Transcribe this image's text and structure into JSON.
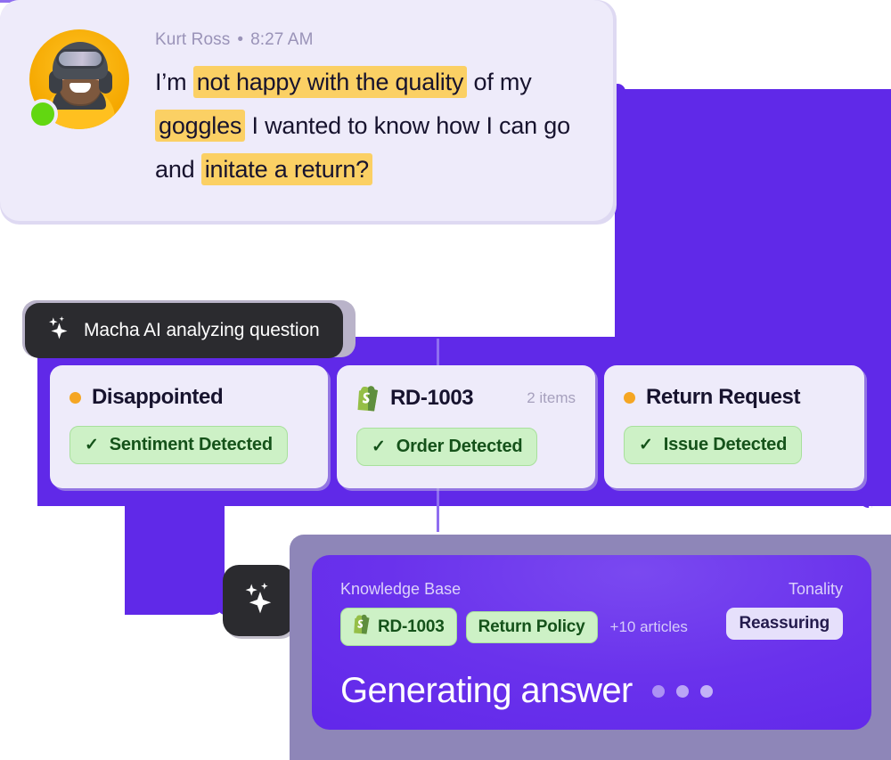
{
  "chat": {
    "author": "Kurt Ross",
    "separator": "•",
    "time": "8:27 AM",
    "message_parts": [
      {
        "text": "I’m ",
        "highlight": false
      },
      {
        "text": "not happy with the quality",
        "highlight": true
      },
      {
        "text": " of my ",
        "highlight": false
      },
      {
        "text": "goggles",
        "highlight": true
      },
      {
        "text": " I wanted to know how I can go and ",
        "highlight": false
      },
      {
        "text": "initate a return?",
        "highlight": true
      }
    ],
    "avatar_icon": "user-avatar-photo",
    "status_icon": "online-status-dot",
    "status_color": "#62d711",
    "highlight_color": "#fbd064",
    "bubble_color": "#eeebfa"
  },
  "tooltip": {
    "icon": "sparkle-icon",
    "label": "Macha AI analyzing question",
    "background": "#2b2b2f"
  },
  "cards": [
    {
      "icon": "amber-dot-icon",
      "title": "Disappointed",
      "sub": "",
      "badge_check": "✓",
      "badge_label": "Sentiment Detected"
    },
    {
      "icon": "shopify-icon",
      "title": "RD-1003",
      "sub": "2 items",
      "badge_check": "✓",
      "badge_label": "Order Detected"
    },
    {
      "icon": "amber-dot-icon",
      "title": "Return Request",
      "sub": "",
      "badge_check": "✓",
      "badge_label": "Issue Detected"
    }
  ],
  "spark_badge": {
    "icon": "sparkle-icon"
  },
  "generating": {
    "knowledge_base_label": "Knowledge Base",
    "chips": [
      {
        "icon": "shopify-icon",
        "label": "RD-1003"
      },
      {
        "icon": "",
        "label": "Return Policy"
      }
    ],
    "more_articles": "+10 articles",
    "tonality_label": "Tonality",
    "tonality_value": "Reassuring",
    "status_text": "Generating answer",
    "loading_dots": 3,
    "accent": "#6029e8",
    "chip_color": "#cdf1c6"
  }
}
